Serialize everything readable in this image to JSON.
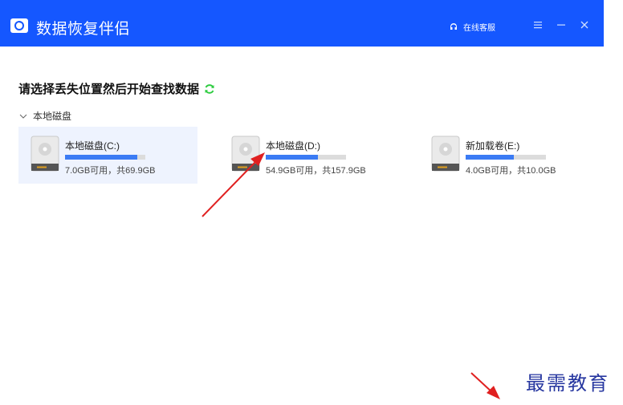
{
  "app": {
    "title": "数据恢复伴侣",
    "brand_color": "#1557ff"
  },
  "header": {
    "support_label": "在线客服"
  },
  "main": {
    "heading": "请选择丢失位置然后开始查找数据",
    "section_label": "本地磁盘",
    "drives": [
      {
        "name": "本地磁盘(C:)",
        "capacity": "7.0GB可用，共69.9GB",
        "used_fraction": 0.9,
        "selected": true
      },
      {
        "name": "本地磁盘(D:)",
        "capacity": "54.9GB可用，共157.9GB",
        "used_fraction": 0.65,
        "selected": false
      },
      {
        "name": "新加载卷(E:)",
        "capacity": "4.0GB可用，共10.0GB",
        "used_fraction": 0.6,
        "selected": false
      }
    ]
  },
  "watermark": "最需教育",
  "colors": {
    "bar_fill": "#3b7bf4",
    "bar_track": "#dcdcdc",
    "refresh_icon": "#2ecc40",
    "annotation_arrow": "#e02020"
  }
}
